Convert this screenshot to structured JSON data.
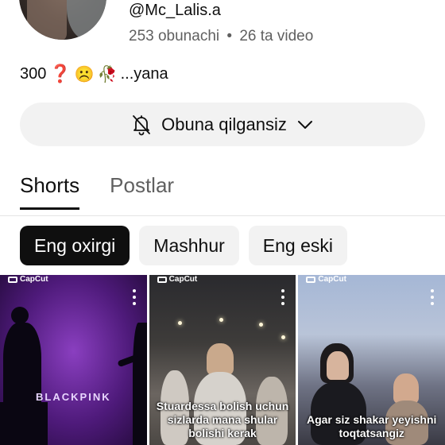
{
  "channel": {
    "handle": "@Mc_Lalis.a",
    "subscribers": "253 obunachi",
    "separator": "•",
    "videos": "26 ta video",
    "bio": {
      "prefix": "300",
      "question": "❓",
      "sad": "☹️",
      "flower": "🥀",
      "suffix": "...yana"
    }
  },
  "subscribe_button": {
    "label": "Obuna qilgansiz",
    "icon": "bell-off-icon",
    "dropdown_icon": "chevron-down-icon"
  },
  "tabs": [
    {
      "label": "Shorts",
      "active": true
    },
    {
      "label": "Postlar",
      "active": false
    }
  ],
  "filters": [
    {
      "label": "Eng oxirgi",
      "selected": true
    },
    {
      "label": "Mashhur",
      "selected": false
    },
    {
      "label": "Eng eski",
      "selected": false
    }
  ],
  "shorts": [
    {
      "watermark": "CapCut",
      "overlay_text": "BLACKPINK",
      "caption": ""
    },
    {
      "watermark": "CapCut",
      "overlay_text": "",
      "caption": "Stuardessa bolish uchun sizlarda mana shular bolishi kerak"
    },
    {
      "watermark": "CapCut",
      "overlay_text": "",
      "caption": "Agar siz shakar yeyishni toqtatsangiz"
    }
  ],
  "colors": {
    "chip_selected_bg": "#0f0f0f",
    "chip_bg": "#f2f2f2",
    "muted_text": "#606060"
  }
}
